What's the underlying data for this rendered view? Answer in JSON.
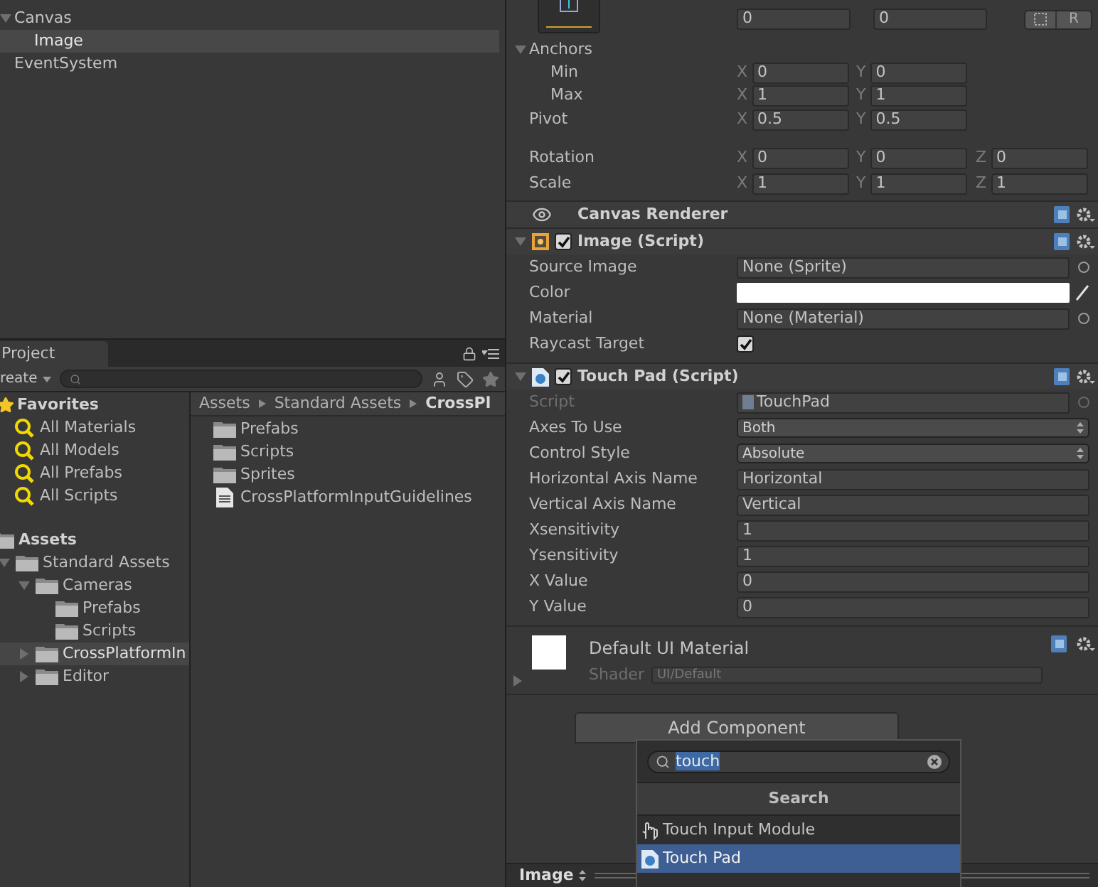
{
  "hierarchy": {
    "items": [
      {
        "label": "Canvas",
        "expanded": true,
        "selected": false,
        "children": [
          {
            "label": "Image",
            "selected": true
          }
        ]
      },
      {
        "label": "EventSystem",
        "selected": false
      }
    ]
  },
  "project": {
    "tab": "Project",
    "create": "reate",
    "favorites": {
      "label": "Favorites",
      "items": [
        "All Materials",
        "All Models",
        "All Prefabs",
        "All Scripts"
      ]
    },
    "assets": {
      "label": "Assets",
      "children": [
        {
          "label": "Standard Assets",
          "expanded": true,
          "selected": false,
          "children": [
            {
              "label": "Cameras",
              "expanded": true,
              "selected": false,
              "children": [
                {
                  "label": "Prefabs",
                  "selected": false
                },
                {
                  "label": "Scripts",
                  "selected": false
                }
              ]
            },
            {
              "label": "CrossPlatformIn",
              "expanded": false,
              "selected": true
            },
            {
              "label": "Editor",
              "expanded": false,
              "selected": false
            }
          ]
        }
      ]
    },
    "breadcrumb": [
      "Assets",
      "Standard Assets",
      "CrossPl"
    ],
    "files": [
      {
        "label": "Prefabs",
        "kind": "folder"
      },
      {
        "label": "Scripts",
        "kind": "folder"
      },
      {
        "label": "Sprites",
        "kind": "folder"
      },
      {
        "label": "CrossPlatformInputGuidelines",
        "kind": "document"
      }
    ]
  },
  "inspector": {
    "offsets": [
      "0",
      "0"
    ],
    "raw_button": "R",
    "anchors": {
      "label": "Anchors",
      "expanded": true,
      "rows": [
        {
          "label": "Min",
          "axes": [
            {
              "axis": "X",
              "value": "0"
            },
            {
              "axis": "Y",
              "value": "0"
            }
          ]
        },
        {
          "label": "Max",
          "axes": [
            {
              "axis": "X",
              "value": "1"
            },
            {
              "axis": "Y",
              "value": "1"
            }
          ]
        }
      ]
    },
    "pivot": {
      "label": "Pivot",
      "axes": [
        {
          "axis": "X",
          "value": "0.5"
        },
        {
          "axis": "Y",
          "value": "0.5"
        }
      ]
    },
    "transforms": [
      {
        "label": "Rotation",
        "axes": [
          {
            "axis": "X",
            "value": "0"
          },
          {
            "axis": "Y",
            "value": "0"
          },
          {
            "axis": "Z",
            "value": "0"
          }
        ]
      },
      {
        "label": "Scale",
        "axes": [
          {
            "axis": "X",
            "value": "1"
          },
          {
            "axis": "Y",
            "value": "1"
          },
          {
            "axis": "Z",
            "value": "1"
          }
        ]
      }
    ],
    "components": [
      {
        "kind": "renderer",
        "title": "Canvas Renderer"
      },
      {
        "kind": "image",
        "title": "Image (Script)",
        "enabled": true,
        "expanded": true,
        "properties": [
          {
            "label": "Source Image",
            "kind": "object",
            "value": "None (Sprite)"
          },
          {
            "label": "Color",
            "kind": "color",
            "color": "#ffffff"
          },
          {
            "label": "Material",
            "kind": "object",
            "value": "None (Material)"
          },
          {
            "label": "Raycast Target",
            "kind": "checkbox",
            "checked": true
          }
        ]
      },
      {
        "kind": "csharp",
        "title": "Touch Pad (Script)",
        "enabled": true,
        "expanded": true,
        "properties": [
          {
            "label": "Script",
            "kind": "script",
            "value": "TouchPad"
          },
          {
            "label": "Axes To Use",
            "kind": "dropdown",
            "value": "Both"
          },
          {
            "label": "Control Style",
            "kind": "dropdown",
            "value": "Absolute"
          },
          {
            "label": "Horizontal Axis Name",
            "kind": "text",
            "value": "Horizontal"
          },
          {
            "label": "Vertical Axis Name",
            "kind": "text",
            "value": "Vertical"
          },
          {
            "label": "Xsensitivity",
            "kind": "text",
            "value": "1"
          },
          {
            "label": "Ysensitivity",
            "kind": "text",
            "value": "1"
          },
          {
            "label": "X Value",
            "kind": "text",
            "value": "0"
          },
          {
            "label": "Y Value",
            "kind": "text",
            "value": "0"
          }
        ]
      }
    ],
    "material": {
      "name": "Default UI Material",
      "shader_label": "Shader",
      "shader": "UI/Default",
      "expanded": false
    },
    "add_component": "Add Component",
    "popup": {
      "search": "touch",
      "header": "Search",
      "items": [
        {
          "label": "Touch Input Module",
          "kind": "hand",
          "selected": false
        },
        {
          "label": "Touch Pad",
          "kind": "script",
          "selected": true
        }
      ]
    },
    "preview": {
      "title": "Image"
    }
  }
}
